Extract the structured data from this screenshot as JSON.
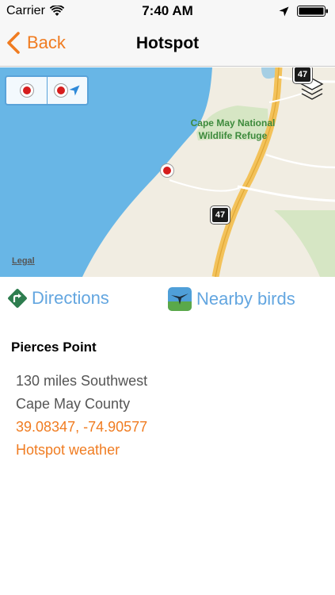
{
  "status_bar": {
    "carrier": "Carrier",
    "time": "7:40 AM",
    "icons": [
      "wifi-icon",
      "location-arrow-icon",
      "battery-icon"
    ]
  },
  "nav": {
    "back_label": "Back",
    "title": "Hotspot"
  },
  "map": {
    "refuge_label": "Cape May National Wildlife Refuge",
    "route_shield_top": "47",
    "route_shield_mid": "47",
    "legal": "Legal",
    "controls": [
      "hotspot-pin-icon",
      "locate-icon",
      "layers-icon"
    ]
  },
  "actions": {
    "directions_label": "Directions",
    "nearby_label": "Nearby birds"
  },
  "place": {
    "name": "Pierces Point",
    "distance": "130 miles Southwest",
    "county": "Cape May County",
    "coordinates": "39.08347, -74.90577",
    "weather_link": "Hotspot weather"
  },
  "colors": {
    "accent": "#f07c21",
    "link_blue": "#63a6e0",
    "water": "#68b6e6",
    "land": "#f1ede2",
    "park": "#d6e6c4",
    "highway": "#f3c25a",
    "pin": "#d61d1d"
  }
}
